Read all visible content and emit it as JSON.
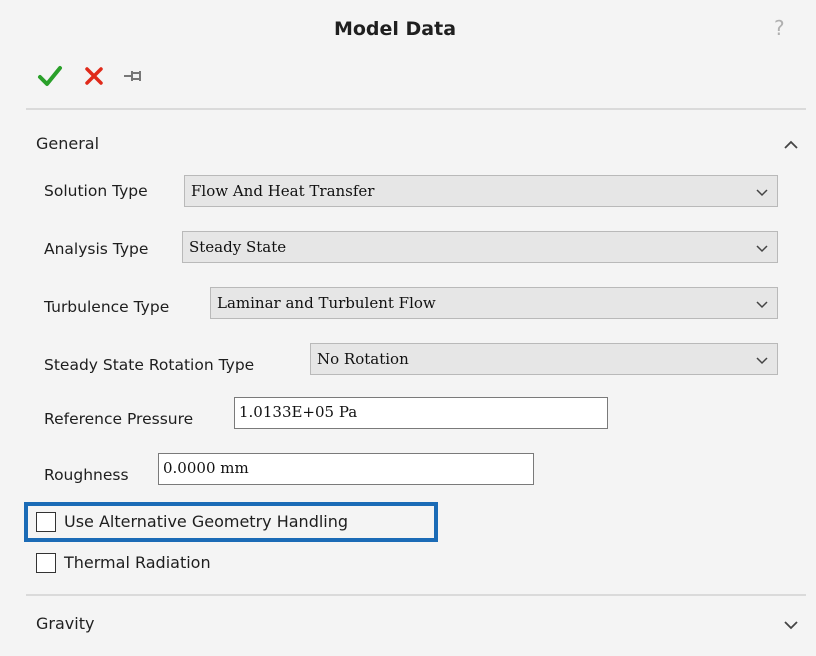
{
  "window": {
    "title": "Model Data",
    "help_glyph": "?"
  },
  "toolbar": {
    "ok_icon": "checkmark-icon",
    "cancel_icon": "close-icon",
    "pin_icon": "pushpin-icon",
    "ok_color": "#2aa02a",
    "cancel_color": "#e02a1a"
  },
  "general": {
    "header": "General",
    "state": "expanded",
    "solution_type": {
      "label": "Solution Type",
      "value": "Flow And Heat Transfer"
    },
    "analysis_type": {
      "label": "Analysis Type",
      "value": "Steady State"
    },
    "turbulence_type": {
      "label": "Turbulence Type",
      "value": "Laminar and Turbulent Flow"
    },
    "rotation_type": {
      "label": "Steady State Rotation Type",
      "value": "No Rotation"
    },
    "reference_pressure": {
      "label": "Reference Pressure",
      "value": "1.0133E+05 Pa"
    },
    "roughness": {
      "label": "Roughness",
      "value": "0.0000 mm"
    },
    "alt_geometry": {
      "label": "Use Alternative Geometry Handling",
      "checked": false
    },
    "thermal_radiation": {
      "label": "Thermal Radiation",
      "checked": false
    }
  },
  "gravity": {
    "header": "Gravity",
    "state": "collapsed"
  },
  "highlight_color": "#1b6bb6"
}
